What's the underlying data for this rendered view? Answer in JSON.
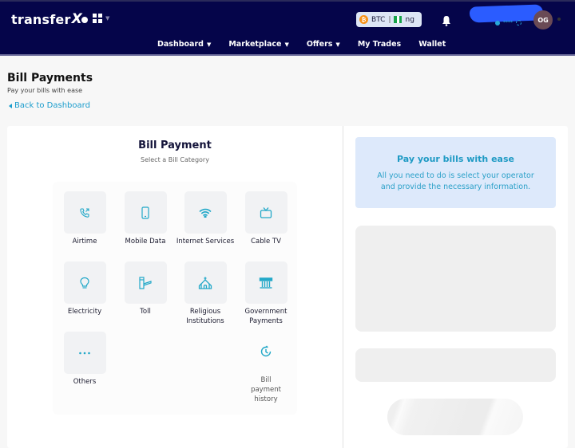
{
  "header": {
    "brand": "transfer",
    "brand_x": "X",
    "currency": {
      "coin": "BTC",
      "separator": "|",
      "country": "ng"
    },
    "user": {
      "initials": "OG",
      "masked": "****"
    },
    "nav": [
      {
        "label": "Dashboard",
        "dropdown": true
      },
      {
        "label": "Marketplace",
        "dropdown": true
      },
      {
        "label": "Offers",
        "dropdown": true
      },
      {
        "label": "My Trades",
        "dropdown": false
      },
      {
        "label": "Wallet",
        "dropdown": false
      }
    ],
    "caret": "▼"
  },
  "page": {
    "title": "Bill Payments",
    "subtitle": "Pay your bills with ease",
    "back_link": "Back to Dashboard"
  },
  "bill_payment": {
    "title": "Bill Payment",
    "subtitle": "Select a Bill Category",
    "categories": [
      {
        "label": "Airtime",
        "icon": "phone-call-icon"
      },
      {
        "label": "Mobile Data",
        "icon": "mobile-phone-icon"
      },
      {
        "label": "Internet Services",
        "icon": "wifi-icon"
      },
      {
        "label": "Cable TV",
        "icon": "tv-icon"
      },
      {
        "label": "Electricity",
        "icon": "lightbulb-icon"
      },
      {
        "label": "Toll",
        "icon": "toll-gate-icon"
      },
      {
        "label": "Religious Institutions",
        "icon": "church-icon"
      },
      {
        "label": "Government Payments",
        "icon": "government-building-icon"
      },
      {
        "label": "Others",
        "icon": "more-dots-icon"
      }
    ],
    "history": {
      "label": "Bill payment history",
      "icon": "history-clock-icon"
    }
  },
  "info": {
    "title": "Pay your bills with ease",
    "text": "All you need to do is select your operator and provide the necessary information."
  },
  "colors": {
    "header_bg": "#05054a",
    "accent": "#1a9ccc",
    "info_bg": "#dde9fb",
    "btc": "#f7931a"
  }
}
